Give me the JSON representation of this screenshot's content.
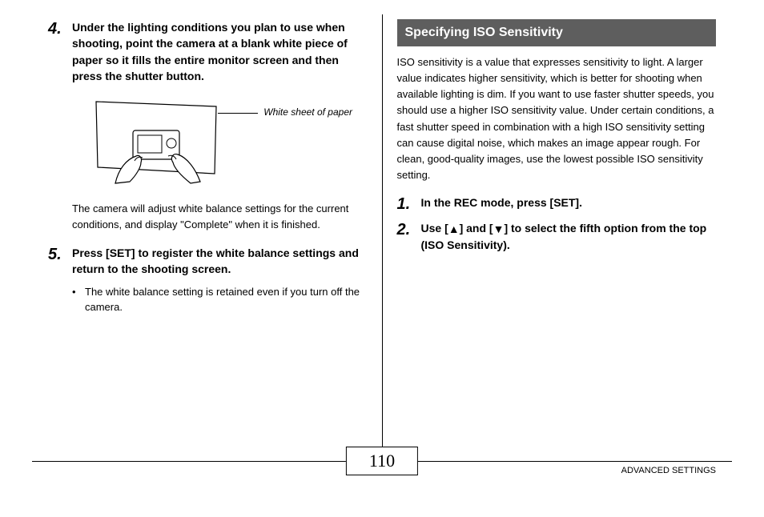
{
  "left": {
    "step4": {
      "num": "4.",
      "text": "Under the lighting conditions you plan to use when shooting, point the camera at a blank white piece of paper so it fills the entire monitor screen and then press the shutter button."
    },
    "figure_caption": "White sheet of paper",
    "after_figure": "The camera will adjust white balance settings for the current conditions, and display \"Complete\" when it is finished.",
    "step5": {
      "num": "5.",
      "text": "Press [SET] to register the white balance settings and return to the shooting screen."
    },
    "bullet": "The white balance setting is retained even if you turn off the camera."
  },
  "right": {
    "header": "Specifying ISO Sensitivity",
    "para": "ISO sensitivity is a value that expresses sensitivity to light. A larger value indicates higher sensitivity, which is better for shooting when available lighting is dim. If you want to use faster shutter speeds, you should use a higher ISO sensitivity value. Under certain conditions, a fast shutter speed in combination with a high ISO sensitivity setting can cause digital noise, which makes an image appear rough. For clean, good-quality images, use the lowest possible ISO sensitivity setting.",
    "step1": {
      "num": "1.",
      "text": "In the REC mode, press [SET]."
    },
    "step2": {
      "num": "2.",
      "prefix": "Use [",
      "mid": "] and [",
      "suffix": "] to select the fifth option from the top (ISO Sensitivity)."
    }
  },
  "footer": {
    "page_number": "110",
    "section": "ADVANCED SETTINGS"
  }
}
